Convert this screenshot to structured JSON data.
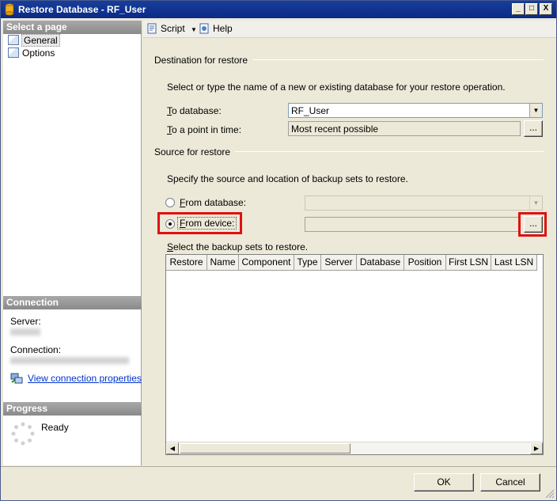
{
  "window": {
    "title": "Restore Database - RF_User",
    "minimize": "_",
    "maximize": "□",
    "close": "X"
  },
  "left": {
    "select_page_header": "Select a page",
    "pages": [
      {
        "label": "General",
        "icon": "page-icon",
        "selected": true
      },
      {
        "label": "Options",
        "icon": "page-icon",
        "selected": false
      }
    ],
    "connection_header": "Connection",
    "server_label": "Server:",
    "connection_label": "Connection:",
    "view_connection_link": "View connection properties",
    "progress_header": "Progress",
    "progress_status": "Ready"
  },
  "toolbar": {
    "script_label": "Script",
    "help_label": "Help"
  },
  "destination": {
    "group_label": "Destination for restore",
    "description": "Select or type the name of a new or existing database for your restore operation.",
    "to_database_prefix": "T",
    "to_database_rest": "o database:",
    "to_database_value": "RF_User",
    "to_point_prefix": "T",
    "to_point_rest": "o a point in time:",
    "to_point_value": "Most recent possible",
    "ellipsis": "..."
  },
  "source": {
    "group_label": "Source for restore",
    "description": "Specify the source and location of backup sets to restore.",
    "from_database_prefix": "F",
    "from_database_rest": "rom database:",
    "from_device_prefix": "F",
    "from_device_rest": "rom device:",
    "device_browse": "...",
    "select_sets_prefix": "S",
    "select_sets_rest": "elect the backup sets to restore."
  },
  "grid": {
    "columns": [
      "Restore",
      "Name",
      "Component",
      "Type",
      "Server",
      "Database",
      "Position",
      "First LSN",
      "Last LSN"
    ],
    "scroll_left": "◀",
    "scroll_right": "▶"
  },
  "buttons": {
    "ok": "OK",
    "cancel": "Cancel"
  },
  "colors": {
    "highlight": "#e01010",
    "titlebar": "#0b2a86",
    "link": "#0033cc"
  }
}
